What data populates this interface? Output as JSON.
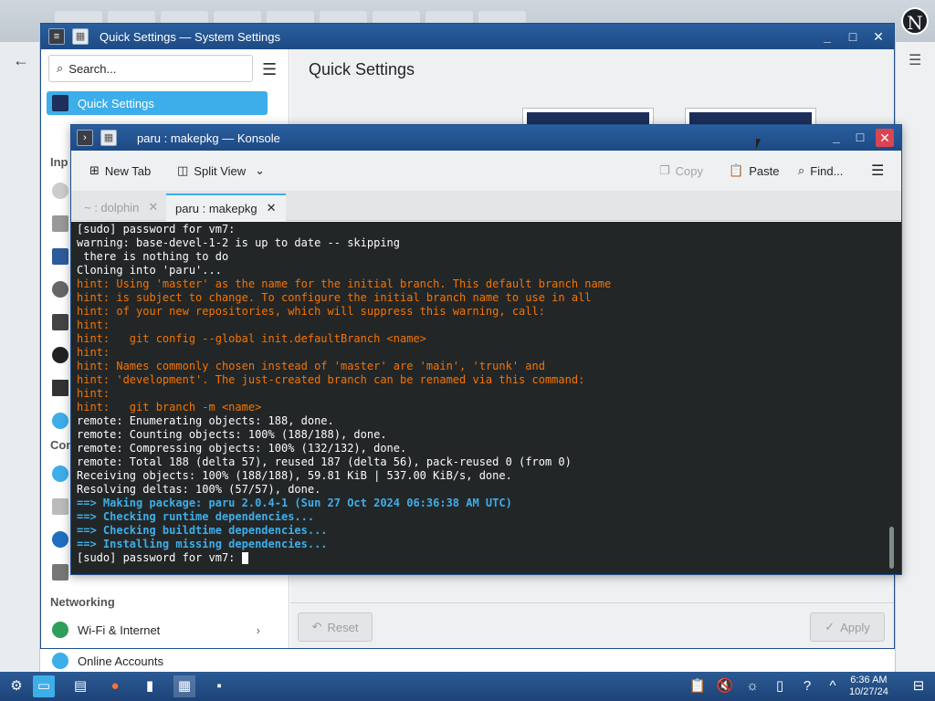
{
  "background": {
    "avatar_letter": "N"
  },
  "settings_window": {
    "title": "Quick Settings — System Settings",
    "search_placeholder": "Search...",
    "page_title": "Quick Settings",
    "sidebar": {
      "selected": "Quick Settings",
      "header_input": "Inp",
      "header_connected": "Con",
      "header_networking": "Networking",
      "items": [
        "Wi-Fi & Internet",
        "Online Accounts"
      ]
    },
    "footer": {
      "reset": "Reset",
      "apply": "Apply"
    }
  },
  "konsole": {
    "title": "paru : makepkg — Konsole",
    "toolbar": {
      "new_tab": "New Tab",
      "split_view": "Split View",
      "copy": "Copy",
      "paste": "Paste",
      "find": "Find..."
    },
    "tabs": [
      "~ : dolphin",
      "paru : makepkg"
    ],
    "lines": [
      {
        "t": "[sudo] password for vm7:",
        "c": "white"
      },
      {
        "t": "warning: base-devel-1-2 is up to date -- skipping",
        "c": "white"
      },
      {
        "t": " there is nothing to do",
        "c": "white"
      },
      {
        "t": "Cloning into 'paru'...",
        "c": "white"
      },
      {
        "t": "hint: Using 'master' as the name for the initial branch. This default branch name",
        "c": "orange"
      },
      {
        "t": "hint: is subject to change. To configure the initial branch name to use in all",
        "c": "orange"
      },
      {
        "t": "hint: of your new repositories, which will suppress this warning, call:",
        "c": "orange"
      },
      {
        "t": "hint:",
        "c": "orange"
      },
      {
        "t": "hint:   git config --global init.defaultBranch <name>",
        "c": "orange"
      },
      {
        "t": "hint:",
        "c": "orange"
      },
      {
        "t": "hint: Names commonly chosen instead of 'master' are 'main', 'trunk' and",
        "c": "orange"
      },
      {
        "t": "hint: 'development'. The just-created branch can be renamed via this command:",
        "c": "orange"
      },
      {
        "t": "hint:",
        "c": "orange"
      },
      {
        "t": "hint:   git branch -m <name>",
        "c": "orange"
      },
      {
        "t": "remote: Enumerating objects: 188, done.",
        "c": "white"
      },
      {
        "t": "remote: Counting objects: 100% (188/188), done.",
        "c": "white"
      },
      {
        "t": "remote: Compressing objects: 100% (132/132), done.",
        "c": "white"
      },
      {
        "t": "remote: Total 188 (delta 57), reused 187 (delta 56), pack-reused 0 (from 0)",
        "c": "white"
      },
      {
        "t": "Receiving objects: 100% (188/188), 59.81 KiB | 537.00 KiB/s, done.",
        "c": "white"
      },
      {
        "t": "Resolving deltas: 100% (57/57), done.",
        "c": "white"
      },
      {
        "t": "==> Making package: paru 2.0.4-1 (Sun 27 Oct 2024 06:36:38 AM UTC)",
        "c": "blue"
      },
      {
        "t": "==> Checking runtime dependencies...",
        "c": "blue"
      },
      {
        "t": "==> Checking buildtime dependencies...",
        "c": "blue"
      },
      {
        "t": "==> Installing missing dependencies...",
        "c": "blue"
      },
      {
        "t": "[sudo] password for vm7: ",
        "c": "white",
        "cursor": true
      }
    ]
  },
  "taskbar": {
    "time": "6:36 AM",
    "date": "10/27/24"
  },
  "colors": {
    "accent": "#3daee9",
    "titlebar": "#1d4a84",
    "terminal_bg": "#232627",
    "hint": "#f67400"
  }
}
